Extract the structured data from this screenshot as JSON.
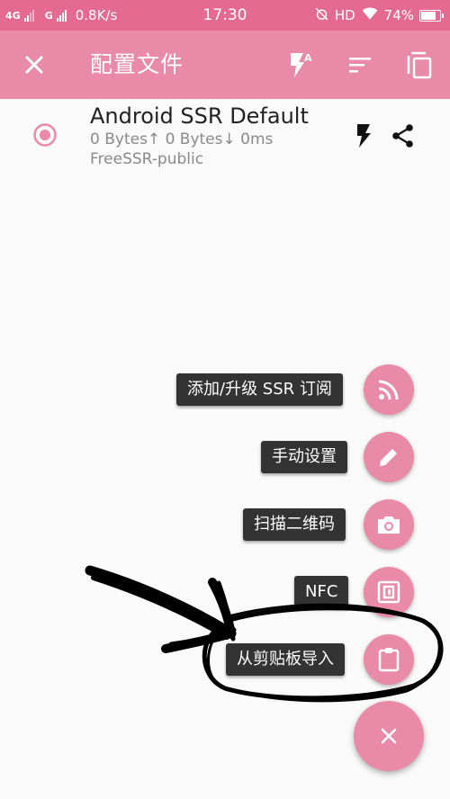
{
  "status_bar": {
    "network_1": "4G",
    "network_2": "G",
    "speed": "0.8K/s",
    "time": "17:30",
    "hd": "HD",
    "battery": "74%",
    "battery_fraction": 0.74,
    "icons": [
      "signal-icon",
      "signal-icon",
      "alarm-off-icon",
      "wifi-icon",
      "battery-icon"
    ]
  },
  "toolbar": {
    "title": "配置文件",
    "close_icon": "close-icon",
    "actions": [
      "flash-auto-icon",
      "sort-icon",
      "copy-icon"
    ]
  },
  "profile": {
    "name": "Android SSR Default",
    "stats": "0 Bytes↑ 0 Bytes↓ 0ms",
    "group": "FreeSSR-public",
    "selected": true,
    "actions": [
      "flash-icon",
      "share-icon"
    ]
  },
  "fab_menu": {
    "items": [
      {
        "label": "添加/升级 SSR 订阅",
        "icon": "rss-icon"
      },
      {
        "label": "手动设置",
        "icon": "pencil-icon"
      },
      {
        "label": "扫描二维码",
        "icon": "camera-icon"
      },
      {
        "label": "NFC",
        "icon": "nfc-icon"
      },
      {
        "label": "从剪贴板导入",
        "icon": "clipboard-icon"
      }
    ],
    "main_icon": "close-icon"
  },
  "colors": {
    "status_bar": "#e46a92",
    "toolbar": "#e98aa8",
    "accent": "#e98aa8",
    "label_bg": "#333333",
    "annotation": "#000000"
  }
}
